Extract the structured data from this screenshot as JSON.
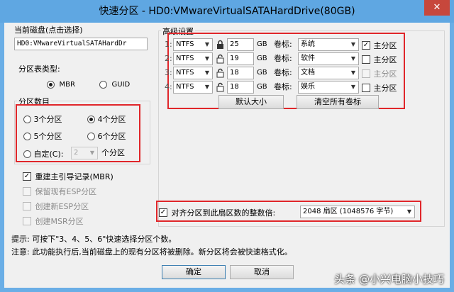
{
  "window": {
    "title": "快速分区 - HD0:VMwareVirtualSATAHardDrive(80GB)",
    "close_glyph": "✕"
  },
  "disk": {
    "label": "当前磁盘(点击选择)",
    "value": "HD0:VMwareVirtualSATAHardDr"
  },
  "table_type": {
    "label": "分区表类型:",
    "options": [
      "MBR",
      "GUID"
    ],
    "selected": "MBR"
  },
  "partition_count": {
    "label": "分区数目",
    "options": [
      "3个分区",
      "4个分区",
      "5个分区",
      "6个分区"
    ],
    "selected": "4个分区",
    "custom_label": "自定(C):",
    "custom_value": "2",
    "custom_suffix": "个分区"
  },
  "options": {
    "rebuild_mbr": "重建主引导记录(MBR)",
    "keep_esp": "保留现有ESP分区",
    "create_esp": "创建新ESP分区",
    "create_msr": "创建MSR分区"
  },
  "advanced": {
    "label": "高级设置",
    "rows": [
      {
        "prefix": "1:",
        "fs": "NTFS",
        "size": "25",
        "unit": "GB",
        "vol_label": "卷标:",
        "volume": "系统",
        "primary": true,
        "primary_enabled": true,
        "locked": true
      },
      {
        "prefix": "2:",
        "fs": "NTFS",
        "size": "19",
        "unit": "GB",
        "vol_label": "卷标:",
        "volume": "软件",
        "primary": false,
        "primary_enabled": true,
        "locked": false
      },
      {
        "prefix": "3:",
        "fs": "NTFS",
        "size": "18",
        "unit": "GB",
        "vol_label": "卷标:",
        "volume": "文档",
        "primary": false,
        "primary_enabled": false,
        "locked": false
      },
      {
        "prefix": "4:",
        "fs": "NTFS",
        "size": "18",
        "unit": "GB",
        "vol_label": "卷标:",
        "volume": "娱乐",
        "primary": false,
        "primary_enabled": true,
        "locked": false
      }
    ],
    "primary_label": "主分区",
    "default_size_btn": "默认大小",
    "clear_labels_btn": "清空所有卷标"
  },
  "align": {
    "label": "对齐分区到此扇区数的整数倍:",
    "value": "2048 扇区 (1048576 字节)"
  },
  "hints": {
    "line1": "提示: 可按下\"3、4、5、6\"快速选择分区个数。",
    "line2": "注意: 此功能执行后,当前磁盘上的现有分区将被删除。新分区将会被快速格式化。"
  },
  "buttons": {
    "ok": "确定",
    "cancel": "取消"
  },
  "watermark": "头条 @小兴电脑小技巧",
  "colors": {
    "accent_red": "#e0262a",
    "title_bar": "#5fa7e2"
  }
}
